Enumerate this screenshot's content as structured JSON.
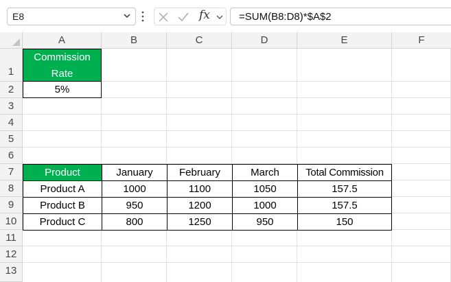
{
  "formula_bar": {
    "name_box": "E8",
    "fx_label": "fx",
    "formula": "=SUM(B8:D8)*$A$2"
  },
  "columns": [
    "A",
    "B",
    "C",
    "D",
    "E",
    "F"
  ],
  "rows": [
    "1",
    "2",
    "3",
    "4",
    "5",
    "6",
    "7",
    "8",
    "9",
    "10",
    "11",
    "12",
    "13"
  ],
  "cells": {
    "A1_line1": "Commission",
    "A1_line2": "Rate",
    "A2": "5%"
  },
  "table": {
    "headers": [
      "Product",
      "January",
      "February",
      "March",
      "Total Commission"
    ],
    "rows": [
      [
        "Product A",
        "1000",
        "1100",
        "1050",
        "157.5"
      ],
      [
        "Product B",
        "950",
        "1200",
        "1000",
        "157.5"
      ],
      [
        "Product C",
        "800",
        "1250",
        "950",
        "150"
      ]
    ]
  },
  "colors": {
    "header_fill": "#00b050",
    "header_text": "#ffffff",
    "grid_line": "#e1e1e1",
    "heading_bg": "#f3f3f3"
  }
}
